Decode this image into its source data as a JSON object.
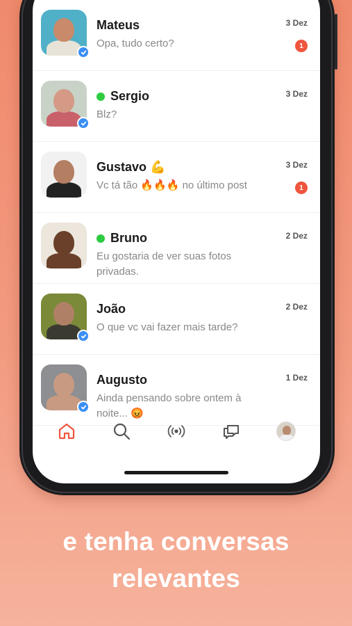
{
  "chats": [
    {
      "name": "Mateus",
      "message": "Opa, tudo certo?",
      "date": "3 Dez",
      "unread": "1",
      "online": false,
      "verified": true,
      "colors": {
        "bg": "#4fb0c8",
        "skin": "#c88a6a",
        "shirt": "#e8e3d8"
      }
    },
    {
      "name": "Sergio",
      "message": "Blz?",
      "date": "3 Dez",
      "unread": "",
      "online": true,
      "verified": true,
      "colors": {
        "bg": "#c9d2c7",
        "skin": "#d49a86",
        "shirt": "#c9616a"
      }
    },
    {
      "name": "Gustavo 💪",
      "message": "Vc tá tão 🔥🔥🔥 no último post",
      "date": "3 Dez",
      "unread": "1",
      "online": false,
      "verified": false,
      "colors": {
        "bg": "#f1f1f1",
        "skin": "#b47e63",
        "shirt": "#222222"
      }
    },
    {
      "name": "Bruno",
      "message": "Eu gostaria de ver suas fotos privadas.",
      "date": "2 Dez",
      "unread": "",
      "online": true,
      "verified": false,
      "colors": {
        "bg": "#ece6dc",
        "skin": "#6a402a",
        "shirt": "#6a402a"
      }
    },
    {
      "name": "João",
      "message": "O que vc vai fazer mais tarde?",
      "date": "2 Dez",
      "unread": "",
      "online": false,
      "verified": true,
      "colors": {
        "bg": "#7a8a38",
        "skin": "#b08066",
        "shirt": "#3a3a32"
      }
    },
    {
      "name": "Augusto",
      "message": "Ainda pensando sobre ontem à noite... 😡",
      "date": "1 Dez",
      "unread": "",
      "online": false,
      "verified": true,
      "colors": {
        "bg": "#8d8f92",
        "skin": "#c89a82",
        "shirt": "#c89a82"
      }
    }
  ],
  "tabbar": {
    "items": [
      {
        "icon": "home-icon",
        "active": true
      },
      {
        "icon": "search-icon",
        "active": false
      },
      {
        "icon": "live-broadcast-icon",
        "active": false
      },
      {
        "icon": "chat-bubbles-icon",
        "active": false
      },
      {
        "icon": "profile-avatar",
        "active": false
      }
    ],
    "active_color": "#f0553d",
    "inactive_color": "#555555"
  },
  "caption": {
    "line1": "e tenha conversas",
    "line2": "relevantes"
  }
}
